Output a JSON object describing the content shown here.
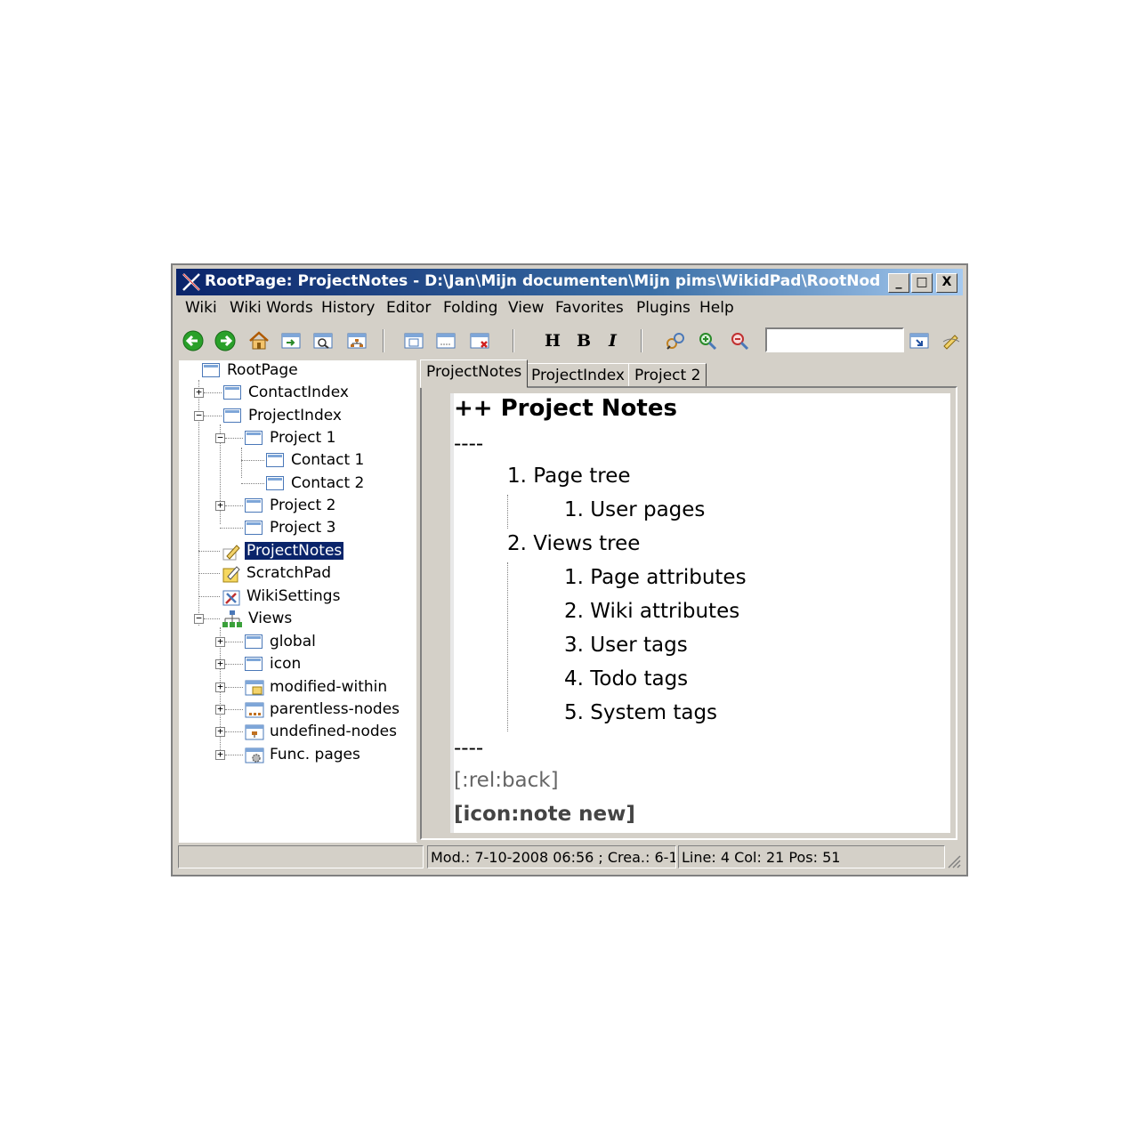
{
  "window": {
    "title": "RootPage: ProjectNotes - D:\\Jan\\Mijn documenten\\Mijn pims\\WikidPad\\RootNode\\...",
    "minimize": "_",
    "maximize": "□",
    "close": "X"
  },
  "menu": [
    "Wiki",
    "Wiki Words",
    "History",
    "Editor",
    "Folding",
    "View",
    "Favorites",
    "Plugins",
    "Help"
  ],
  "toolbar": {
    "heading_label": "H",
    "bold_label": "B",
    "italic_label": "I",
    "search_value": ""
  },
  "tree": [
    {
      "label": "RootPage"
    },
    {
      "label": "ContactIndex"
    },
    {
      "label": "ProjectIndex"
    },
    {
      "label": "Project 1"
    },
    {
      "label": "Contact 1"
    },
    {
      "label": "Contact 2"
    },
    {
      "label": "Project 2"
    },
    {
      "label": "Project 3"
    },
    {
      "label": "ProjectNotes"
    },
    {
      "label": "ScratchPad"
    },
    {
      "label": "WikiSettings"
    },
    {
      "label": "Views"
    },
    {
      "label": "global"
    },
    {
      "label": "icon"
    },
    {
      "label": "modified-within"
    },
    {
      "label": "parentless-nodes"
    },
    {
      "label": "undefined-nodes"
    },
    {
      "label": "Func. pages"
    }
  ],
  "tabs": [
    "ProjectNotes",
    "ProjectIndex",
    "Project 2"
  ],
  "editor": {
    "lines": [
      "++ Project Notes",
      "----",
      "1. Page tree",
      "1. User pages",
      "2. Views tree",
      "1. Page attributes",
      "2. Wiki attributes",
      "3. User tags",
      "4. Todo tags",
      "5. System tags",
      "----",
      "[:rel:back]",
      "[icon:note new]"
    ]
  },
  "status": {
    "left": "",
    "dates": "Mod.: 7-10-2008 06:56 ; Crea.: 6-1",
    "position": "Line: 4 Col: 21 Pos: 51"
  }
}
